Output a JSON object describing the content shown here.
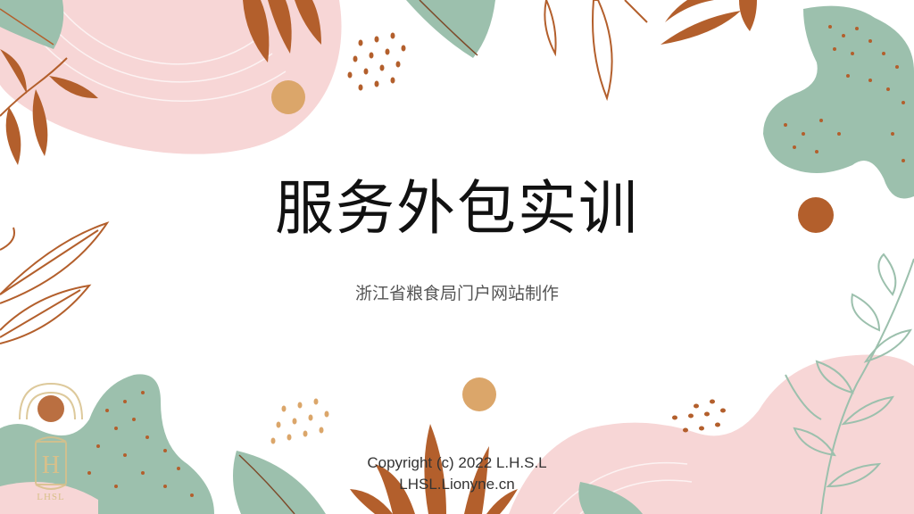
{
  "slide": {
    "title": "服务外包实训",
    "subtitle": "浙江省粮食局门户网站制作",
    "copyright_line1": "Copyright (c) 2022 L.H.S.L",
    "copyright_line2": "LHSL.Lionyne.cn"
  },
  "logo": {
    "mark_text": "H",
    "label": "LHSL"
  },
  "colors": {
    "pink": "#f7d6d6",
    "sage": "#9cc0ad",
    "rust": "#b35f2c",
    "ochre": "#dba66a",
    "gold": "#d8c08a"
  }
}
